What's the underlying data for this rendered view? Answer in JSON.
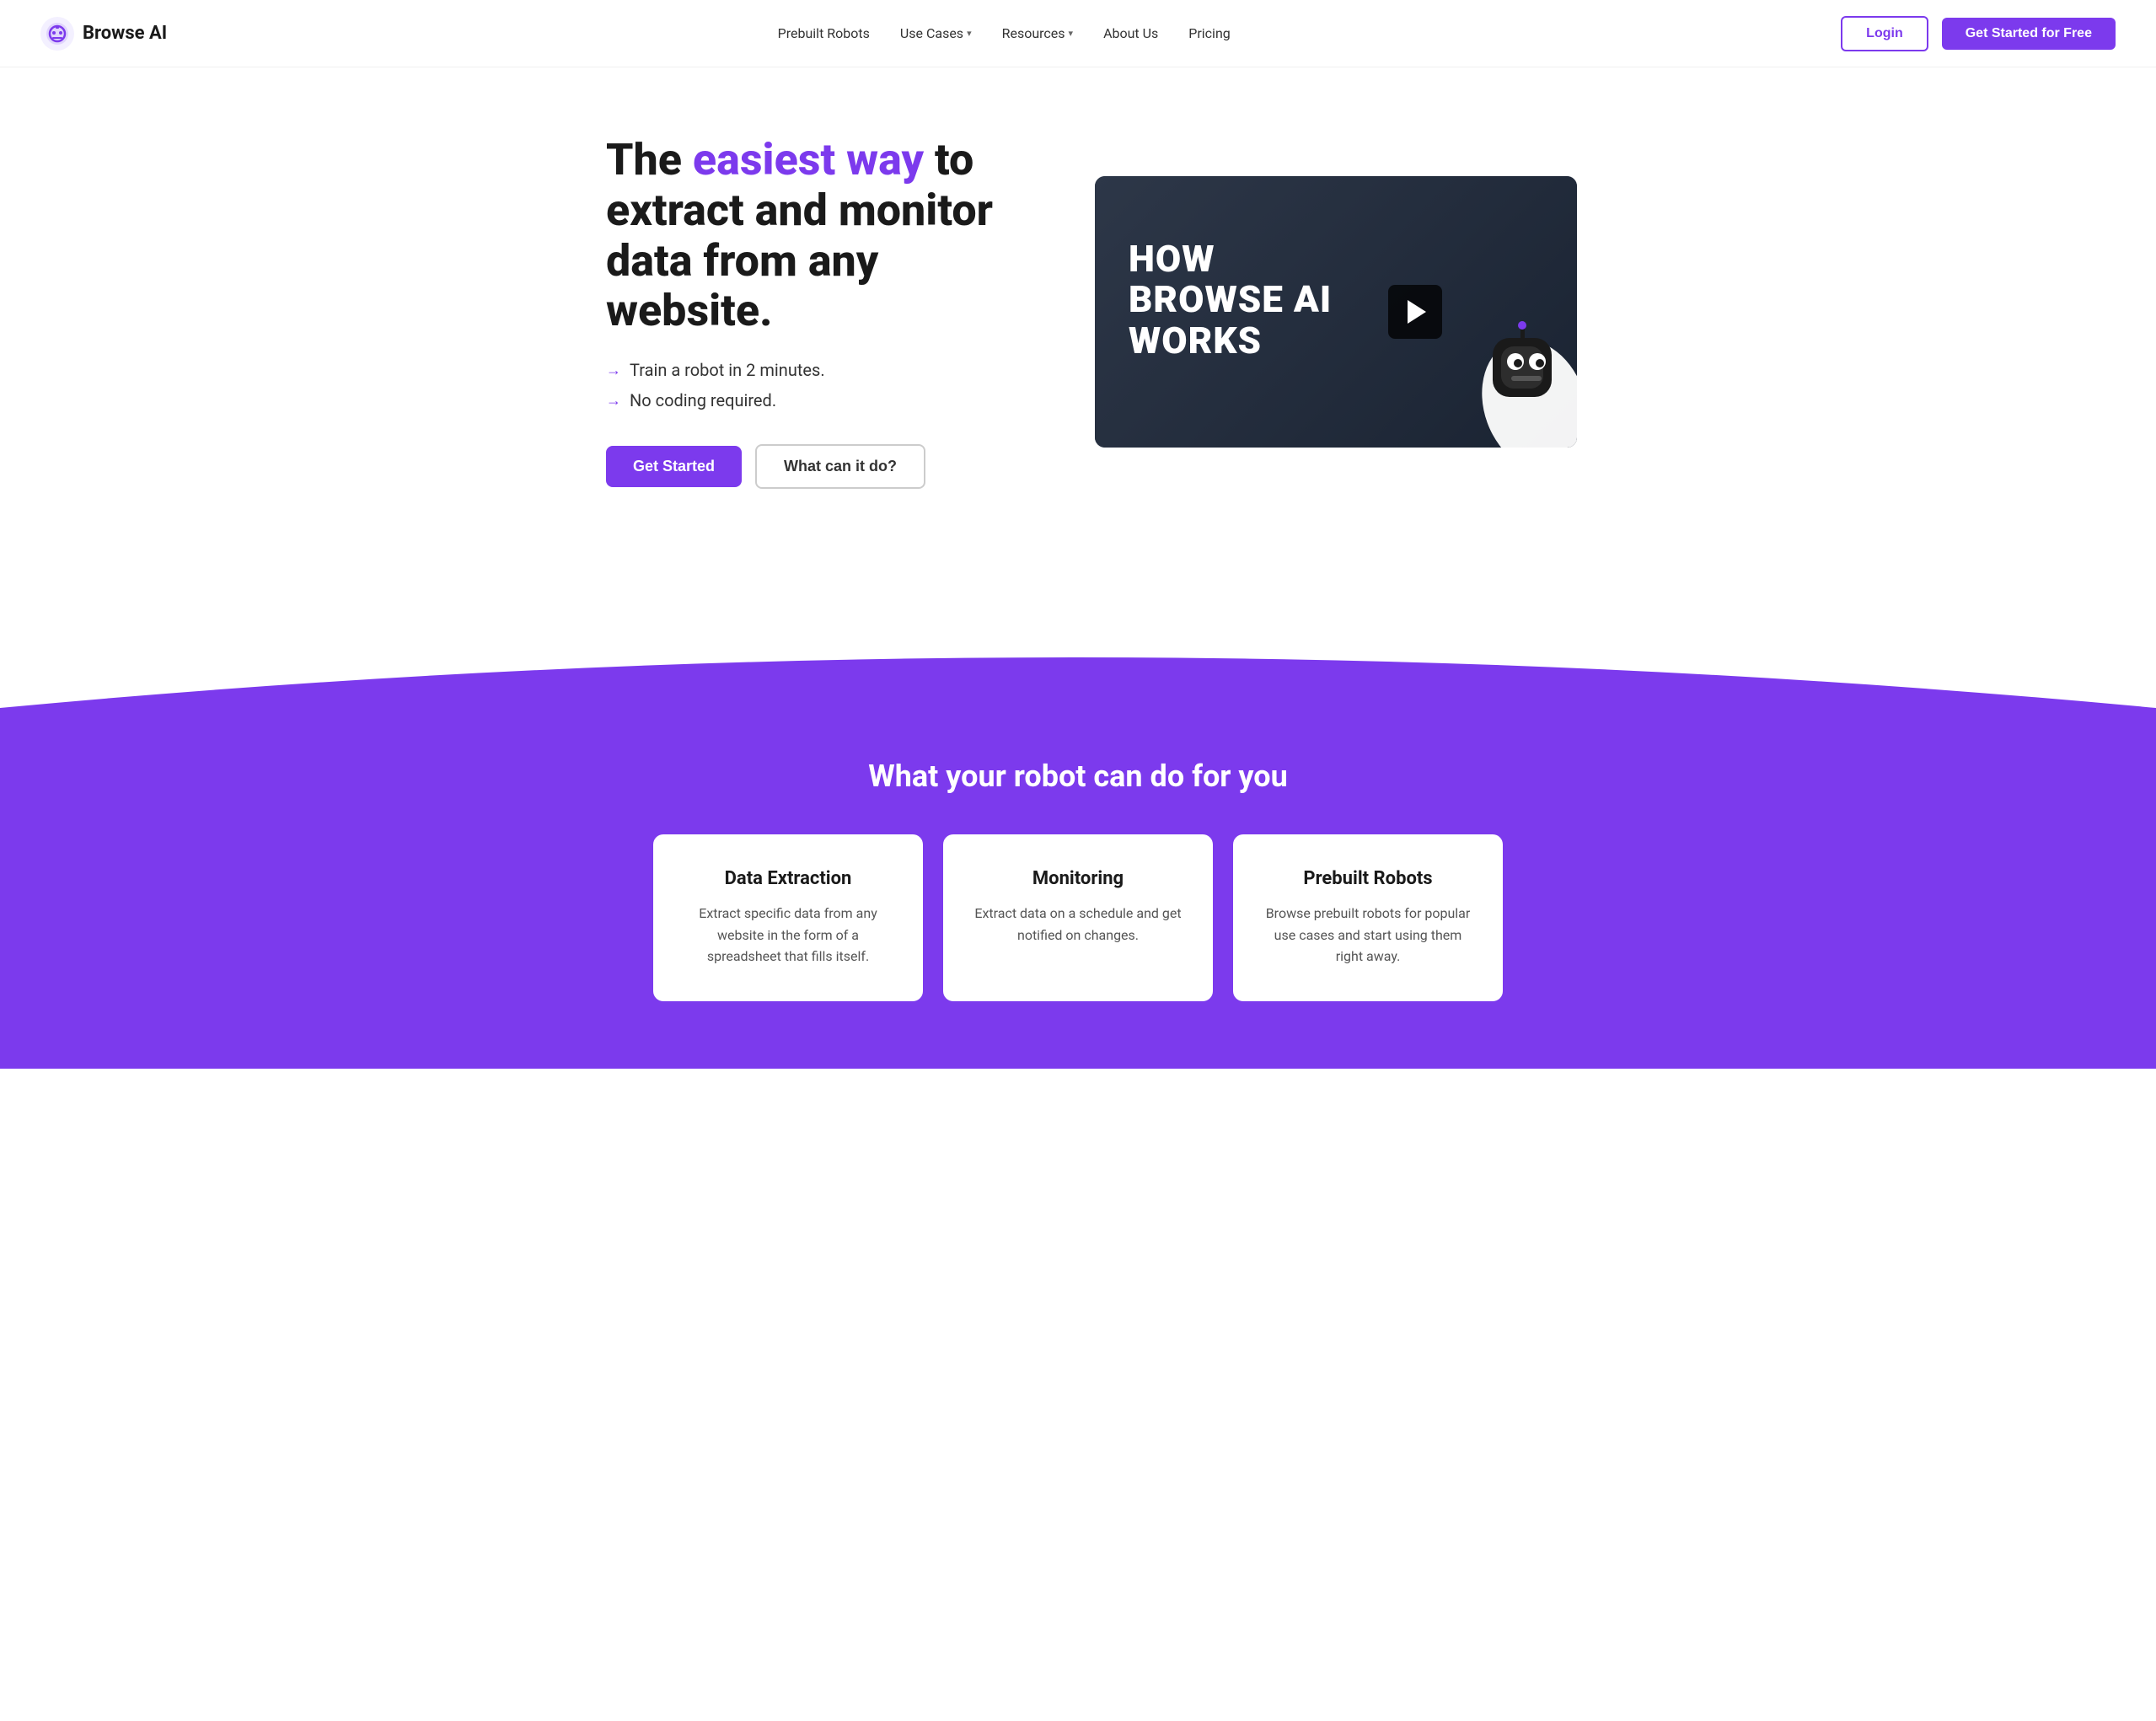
{
  "brand": {
    "name": "Browse AI",
    "logo_alt": "Browse AI Logo"
  },
  "navbar": {
    "nav_items": [
      {
        "label": "Prebuilt Robots",
        "has_dropdown": false
      },
      {
        "label": "Use Cases",
        "has_dropdown": true
      },
      {
        "label": "Resources",
        "has_dropdown": true
      },
      {
        "label": "About Us",
        "has_dropdown": false
      },
      {
        "label": "Pricing",
        "has_dropdown": false
      }
    ],
    "login_label": "Login",
    "cta_label": "Get Started for Free"
  },
  "hero": {
    "title_part1": "The ",
    "title_highlight": "easiest way",
    "title_part2": " to extract and monitor data from any website.",
    "bullets": [
      "Train a robot in 2 minutes.",
      "No coding required."
    ],
    "btn_get_started": "Get Started",
    "btn_what": "What can it do?",
    "video": {
      "title_line1": "HOW",
      "title_line2": "BROWSE AI",
      "title_line3": "WORKS"
    }
  },
  "features": {
    "section_title": "What your robot can do for you",
    "cards": [
      {
        "title": "Data Extraction",
        "description": "Extract specific data from any website in the form of a spreadsheet that fills itself."
      },
      {
        "title": "Monitoring",
        "description": "Extract data on a schedule and get notified on changes."
      },
      {
        "title": "Prebuilt Robots",
        "description": "Browse prebuilt robots for popular use cases and start using them right away."
      }
    ]
  },
  "colors": {
    "primary": "#7c3aed",
    "primary_dark": "#6d28d9",
    "white": "#ffffff",
    "dark": "#1a1a1a",
    "muted": "#555555"
  }
}
